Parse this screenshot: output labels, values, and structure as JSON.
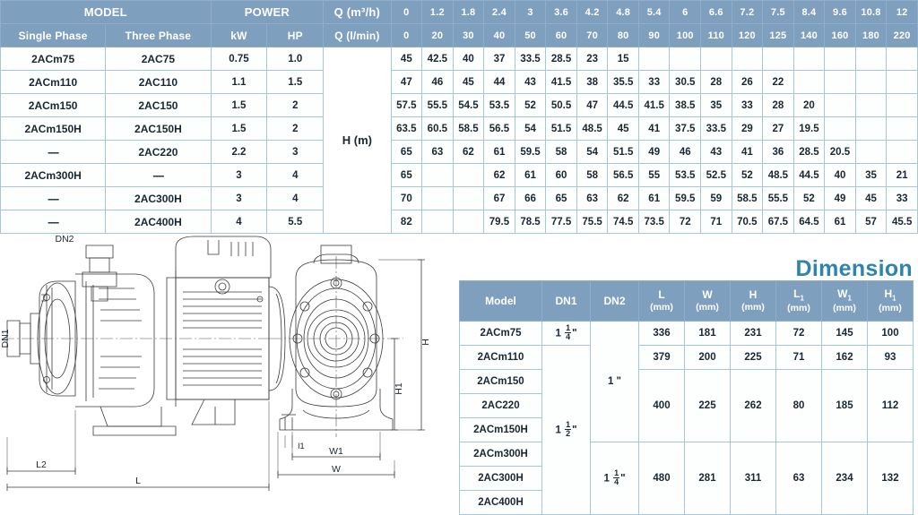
{
  "perf_table": {
    "headers": {
      "model": "MODEL",
      "single_phase": "Single Phase",
      "three_phase": "Three Phase",
      "power": "POWER",
      "kw": "kW",
      "hp": "HP",
      "q_m3h": "Q (m³/h)",
      "q_lmin": "Q (l/min)",
      "h_m": "H (m)"
    },
    "q_m3h_values": [
      "0",
      "1.2",
      "1.8",
      "2.4",
      "3",
      "3.6",
      "4.2",
      "4.8",
      "5.4",
      "6",
      "6.6",
      "7.2",
      "7.5",
      "8.4",
      "9.6",
      "10.8",
      "12"
    ],
    "q_lmin_values": [
      "0",
      "20",
      "30",
      "40",
      "50",
      "60",
      "70",
      "80",
      "90",
      "100",
      "110",
      "120",
      "125",
      "140",
      "160",
      "180",
      "220"
    ],
    "rows": [
      {
        "single": "2ACm75",
        "three": "2AC75",
        "kw": "0.75",
        "hp": "1.0",
        "head": [
          "45",
          "42.5",
          "40",
          "37",
          "33.5",
          "28.5",
          "23",
          "15",
          "",
          "",
          "",
          "",
          "",
          "",
          "",
          "",
          ""
        ]
      },
      {
        "single": "2ACm110",
        "three": "2AC110",
        "kw": "1.1",
        "hp": "1.5",
        "head": [
          "47",
          "46",
          "45",
          "44",
          "43",
          "41.5",
          "38",
          "35.5",
          "33",
          "30.5",
          "28",
          "26",
          "22",
          "",
          "",
          "",
          ""
        ]
      },
      {
        "single": "2ACm150",
        "three": "2AC150",
        "kw": "1.5",
        "hp": "2",
        "head": [
          "57.5",
          "55.5",
          "54.5",
          "53.5",
          "52",
          "50.5",
          "47",
          "44.5",
          "41.5",
          "38.5",
          "35",
          "33",
          "28",
          "20",
          "",
          "",
          ""
        ]
      },
      {
        "single": "2ACm150H",
        "three": "2AC150H",
        "kw": "1.5",
        "hp": "2",
        "head": [
          "63.5",
          "60.5",
          "58.5",
          "56.5",
          "54",
          "51.5",
          "48.5",
          "45",
          "41",
          "37.5",
          "33.5",
          "29",
          "27",
          "19.5",
          "",
          "",
          ""
        ]
      },
      {
        "single": "----",
        "three": "2AC220",
        "kw": "2.2",
        "hp": "3",
        "head": [
          "65",
          "63",
          "62",
          "61",
          "59.5",
          "58",
          "54",
          "51.5",
          "49",
          "46",
          "43",
          "41",
          "36",
          "28.5",
          "20.5",
          "",
          ""
        ]
      },
      {
        "single": "2ACm300H",
        "three": "----",
        "kw": "3",
        "hp": "4",
        "head": [
          "65",
          "",
          "",
          "62",
          "61",
          "60",
          "58",
          "56.5",
          "55",
          "53.5",
          "52.5",
          "52",
          "48.5",
          "44.5",
          "40",
          "35",
          "21"
        ]
      },
      {
        "single": "----",
        "three": "2AC300H",
        "kw": "3",
        "hp": "4",
        "head": [
          "70",
          "",
          "",
          "67",
          "66",
          "65",
          "63",
          "62",
          "61",
          "59.5",
          "59",
          "58.5",
          "55.5",
          "52",
          "49",
          "45",
          "33"
        ]
      },
      {
        "single": "----",
        "three": "2AC400H",
        "kw": "4",
        "hp": "5.5",
        "head": [
          "82",
          "",
          "",
          "79.5",
          "78.5",
          "77.5",
          "75.5",
          "74.5",
          "73.5",
          "72",
          "71",
          "70.5",
          "67.5",
          "64.5",
          "61",
          "57",
          "45.5"
        ]
      }
    ]
  },
  "dimension_section": {
    "title": "Dimension",
    "headers": {
      "model": "Model",
      "dn1": "DN1",
      "dn2": "DN2",
      "l": "L",
      "w": "W",
      "h": "H",
      "l1": "L",
      "w1": "W",
      "h1": "H",
      "sub": "1",
      "unit": "(mm)"
    },
    "models": [
      "2ACm75",
      "2ACm110",
      "2ACm150",
      "2AC220",
      "2ACm150H",
      "2ACm300H",
      "2AC300H",
      "2AC400H"
    ],
    "dn1": [
      {
        "whole": "1",
        "num": "1",
        "den": "4",
        "unit": "\"",
        "rowspan": 1
      },
      {
        "whole": "1",
        "num": "1",
        "den": "2",
        "unit": "\"",
        "rowspan": 7
      }
    ],
    "dn2": [
      {
        "whole": "1",
        "num": "",
        "den": "",
        "unit": "\"",
        "rowspan": 5
      },
      {
        "whole": "1",
        "num": "1",
        "den": "4",
        "unit": "\"",
        "rowspan": 3
      }
    ],
    "dim_groups": [
      {
        "rowspan": 1,
        "L": "336",
        "W": "181",
        "H": "231",
        "L1": "72",
        "W1": "145",
        "H1": "100"
      },
      {
        "rowspan": 1,
        "L": "379",
        "W": "200",
        "H": "225",
        "L1": "71",
        "W1": "162",
        "H1": "93"
      },
      {
        "rowspan": 3,
        "L": "400",
        "W": "225",
        "H": "262",
        "L1": "80",
        "W1": "185",
        "H1": "112"
      },
      {
        "rowspan": 3,
        "L": "480",
        "W": "281",
        "H": "311",
        "L1": "63",
        "W1": "234",
        "H1": "132"
      }
    ]
  },
  "drawings": {
    "side_view": {
      "labels": {
        "dn2": "DN2",
        "dn1": "DN1",
        "l2": "L2",
        "l": "L"
      }
    },
    "front_view": {
      "labels": {
        "h": "H",
        "h1": "H1",
        "w": "W",
        "w1": "W1",
        "l1": "l1"
      }
    }
  },
  "colors": {
    "header_blue": "#7e9fbe",
    "grid_blue": "#a9c5da",
    "title_teal": "#2e84ac",
    "text_dark": "#1a2733",
    "line_gray": "#3a3a3a"
  }
}
